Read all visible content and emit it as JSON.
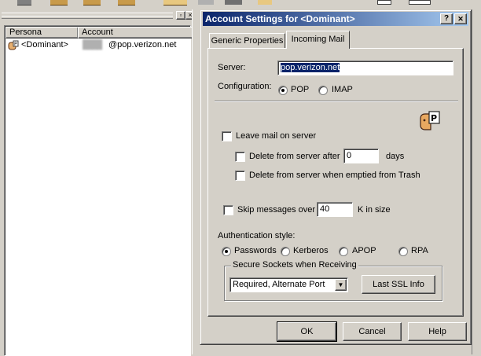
{
  "list_panel": {
    "columns": [
      "Persona",
      "Account"
    ],
    "rows": [
      {
        "persona": "<Dominant>",
        "account": "@pop.verizon.net",
        "blurred_user": "████"
      }
    ]
  },
  "dialog": {
    "title": "Account Settings for <Dominant>",
    "help_glyph": "?",
    "close_glyph": "✕",
    "tabs": [
      {
        "label": "Generic Properties",
        "active": false
      },
      {
        "label": "Incoming Mail",
        "active": true
      }
    ],
    "server": {
      "label": "Server:",
      "value": "pop.verizon.net"
    },
    "configuration": {
      "label": "Configuration:",
      "options": [
        "POP",
        "IMAP"
      ],
      "selected": "POP"
    },
    "leave_mail": {
      "label": "Leave mail on server",
      "checked": false
    },
    "delete_after": {
      "label": "Delete from server after",
      "value": "0",
      "unit": "days",
      "checked": false
    },
    "delete_trash": {
      "label": "Delete from server when emptied from Trash",
      "checked": false
    },
    "skip_messages": {
      "label": "Skip messages over",
      "value": "40",
      "unit": "K in size",
      "checked": false
    },
    "auth": {
      "label": "Authentication style:",
      "options": [
        "Passwords",
        "Kerberos",
        "APOP",
        "RPA"
      ],
      "selected": "Passwords"
    },
    "ssl": {
      "group_label": "Secure Sockets when Receiving",
      "selected": "Required, Alternate Port",
      "info_button": "Last SSL Info"
    },
    "buttons": {
      "ok": "OK",
      "cancel": "Cancel",
      "help": "Help"
    }
  },
  "colors": {
    "title_bar": "#0a246a",
    "title_bar_end": "#a6caf0",
    "selection": "#0a246a"
  }
}
